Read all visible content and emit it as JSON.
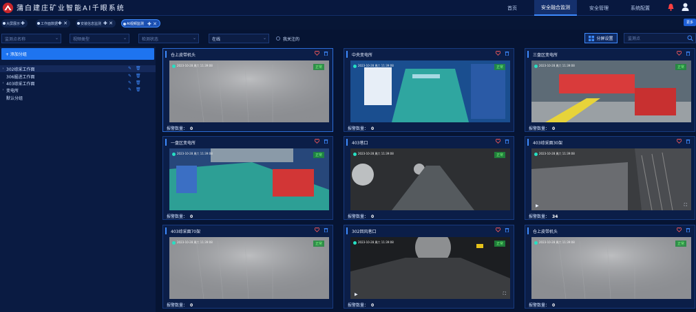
{
  "app": {
    "title": "蒲白建庄矿业智能AI千眼系统",
    "nav": [
      "首页",
      "安全融合监测",
      "安全管理",
      "系统配置"
    ],
    "nav_active": 1
  },
  "tabs": [
    {
      "label": "大屏展示",
      "ctl": "✚"
    },
    {
      "label": "工作面数据",
      "ctl": "✚ ✕"
    },
    {
      "label": "安装信息监测",
      "ctl": "✚ ✕"
    },
    {
      "label": "AI视频监测",
      "ctl": "✚ ✕",
      "active": true
    }
  ],
  "more_label": "更多",
  "filters": {
    "device_name": "监测点名称",
    "video_type": "视频类型",
    "check_status": "检测状态",
    "online": "在线",
    "my_follow": "我关注的",
    "split_settings": "分屏设置",
    "search_placeholder": "监测点"
  },
  "sidebar": {
    "add_group": "+ 添加分组",
    "groups": [
      {
        "label": "302综采工作面",
        "selected": true
      },
      {
        "label": "306掘进工作面"
      },
      {
        "label": "403综采工作面"
      },
      {
        "label": "变电所"
      },
      {
        "label": "默认分组",
        "leaf": true
      }
    ]
  },
  "alarm_label": "报警数量：",
  "cameras": [
    {
      "name": "仓上皮带机头",
      "alarms": "0",
      "status": "正常",
      "scene": "fog",
      "timestamp": "2023-10-28 周六 11:39:08",
      "highlight": true
    },
    {
      "name": "中央变电所",
      "alarms": "0",
      "status": "正常",
      "scene": "substation",
      "timestamp": "2023-10-28 周六 11:39:08"
    },
    {
      "name": "三盘区变电所",
      "alarms": "0",
      "status": "正常",
      "scene": "machines",
      "timestamp": "2023-10-28 周六 11:39:08"
    },
    {
      "name": "一盘区变电所",
      "alarms": "0",
      "status": "正常",
      "scene": "room",
      "timestamp": "2023-10-28 周六 11:39:08"
    },
    {
      "name": "403巷口",
      "alarms": "0",
      "status": "正常",
      "scene": "tunnel",
      "timestamp": "2023-10-28 周六 11:39:08"
    },
    {
      "name": "403综采面30架",
      "alarms": "34",
      "status": "",
      "scene": "face",
      "timestamp": "2023-10-28 周六 11:39:08",
      "controls": true
    },
    {
      "name": "403综采面70架",
      "alarms": "0",
      "status": "正常",
      "scene": "fog",
      "timestamp": "2023-10-28 周六 11:39:08"
    },
    {
      "name": "302回风巷口",
      "alarms": "0",
      "status": "正常",
      "scene": "dark",
      "timestamp": "2023-10-28 周六 11:39:08",
      "controls": true
    },
    {
      "name": "仓上皮带机头",
      "alarms": "0",
      "status": "正常",
      "scene": "fog",
      "timestamp": "2023-10-28 周六 11:39:08"
    }
  ],
  "colors": {
    "accent": "#3e8bff",
    "heart": "#ff5a5a",
    "trash": "#3e8bff",
    "ok": "#7dff7d"
  }
}
